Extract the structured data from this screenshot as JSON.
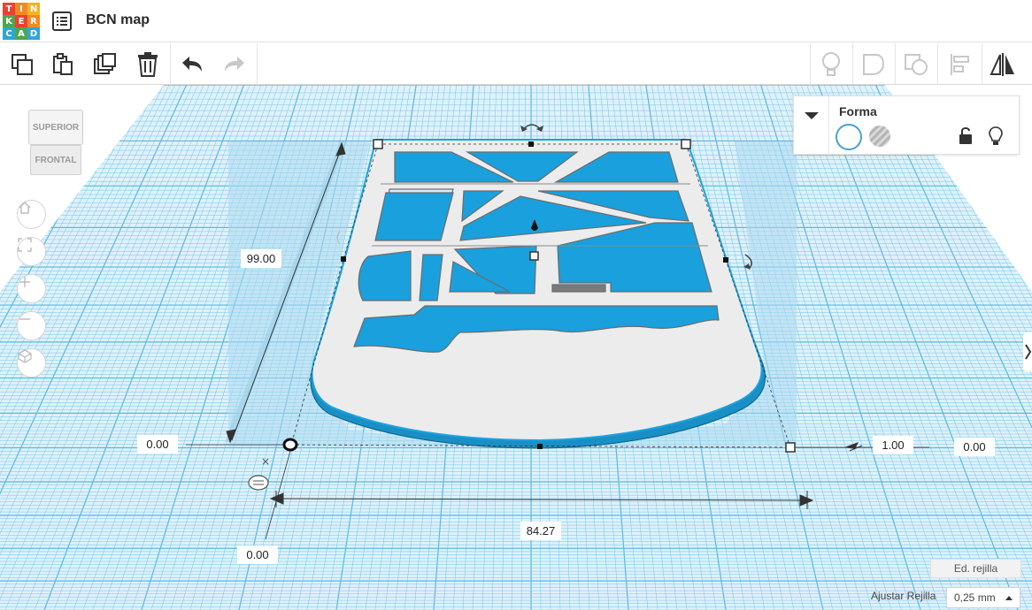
{
  "app": {
    "logo_letters": [
      "T",
      "I",
      "N",
      "K",
      "E",
      "R",
      "C",
      "A",
      "D"
    ],
    "logo_colors": [
      "#e94235",
      "#f08a24",
      "#f0b427",
      "#4ea74e",
      "#e94235",
      "#f08a24",
      "#30a5d8",
      "#4ea74e",
      "#30a5d8"
    ],
    "title": "BCN map"
  },
  "toolbar": {
    "left_icons": [
      "copy-icon",
      "paste-icon",
      "duplicate-icon",
      "delete-icon",
      "undo-icon",
      "redo-icon"
    ],
    "right_icons": [
      "lightbulb-icon",
      "group-icon",
      "ungroup-icon",
      "align-icon",
      "mirror-icon"
    ]
  },
  "viewcube": {
    "top_label": "SUPERIOR",
    "front_label": "FRONTAL"
  },
  "nav": {
    "icons": [
      "home-icon",
      "fit-view-icon",
      "zoom-in-icon",
      "zoom-out-icon",
      "perspective-icon"
    ]
  },
  "shape_panel": {
    "title": "Forma",
    "solid_label": "Sólido",
    "hole_label": "Agujero"
  },
  "dimensions": {
    "length": "99.00",
    "width": "84.27",
    "height": "1.00",
    "origin_x": "0.00",
    "origin_y": "0.00",
    "origin_z": "0.00",
    "elevation": "0.00"
  },
  "grid": {
    "edit_label": "Ed. rejilla",
    "snap_label": "Ajustar Rejilla",
    "snap_value": "0,25 mm"
  },
  "colors": {
    "grid_blue": "#6fc6ec",
    "grid_bg": "#d6eff9",
    "accent": "#1aa3e0",
    "shape_gray": "#e8e8e8"
  }
}
